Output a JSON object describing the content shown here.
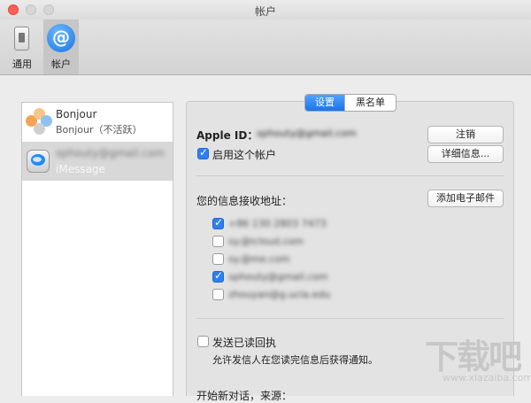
{
  "window": {
    "title": "帐户"
  },
  "toolbar": {
    "general": {
      "label": "通用",
      "icon": "switch-icon"
    },
    "accounts": {
      "label": "帐户",
      "icon": "at-icon"
    }
  },
  "sidebar": {
    "accounts": [
      {
        "name": "Bonjour",
        "subtitle": "Bonjour（不活跃）",
        "icon": "bonjour-icon"
      },
      {
        "name": "sphouty@gmail.com",
        "subtitle": "iMessage",
        "icon": "imessage-icon"
      }
    ]
  },
  "tabs": {
    "settings": "设置",
    "blacklist": "黑名单"
  },
  "settings": {
    "apple_id_label": "Apple ID：",
    "apple_id_value": "sphouty@gmail.com",
    "signout_button": "注销",
    "enable_account": {
      "label": "启用这个帐户",
      "checked": true
    },
    "details_button": "详细信息...",
    "receive_label": "您的信息接收地址：",
    "add_email_button": "添加电子邮件",
    "addresses": [
      {
        "value": "+86 130 2803 7473",
        "checked": true
      },
      {
        "value": "sy.@icloud.com",
        "checked": false
      },
      {
        "value": "sy.@me.com",
        "checked": false
      },
      {
        "value": "sphouty@gmail.com",
        "checked": true
      },
      {
        "value": "zhouyan@g.ucla.edu",
        "checked": false
      }
    ],
    "read_receipt": {
      "label": "发送已读回执",
      "checked": false
    },
    "read_receipt_desc": "允许发信人在您读完信息后获得通知。",
    "start_new_label": "开始新对话，来源："
  },
  "watermark": {
    "text": "下载吧",
    "url": "www.xiazaiba.com"
  }
}
